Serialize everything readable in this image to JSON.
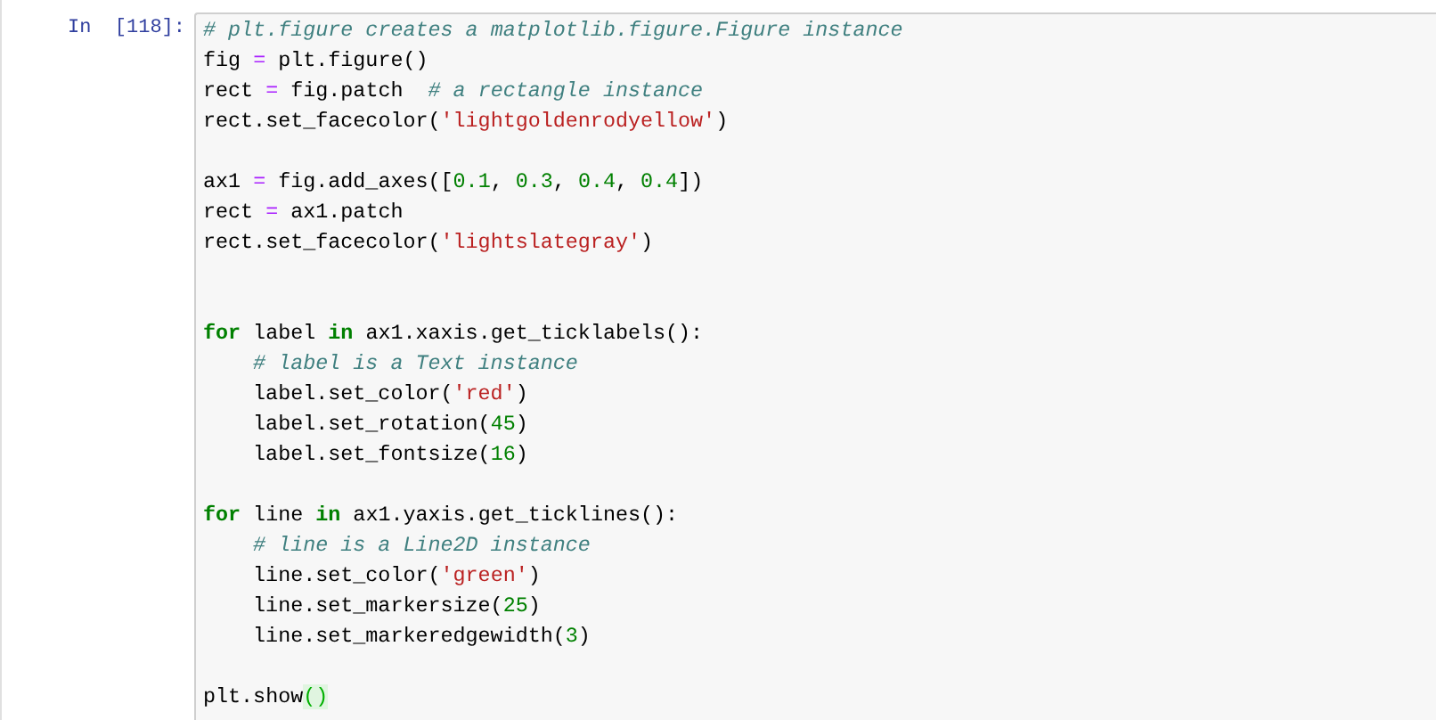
{
  "cell": {
    "prompt": "In  [118]:",
    "lines": [
      {
        "kind": "code",
        "tokens": [
          {
            "kind": "com",
            "text": "# plt.figure creates a matplotlib.figure.Figure instance"
          }
        ]
      },
      {
        "kind": "code",
        "tokens": [
          {
            "kind": "plain",
            "text": "fig "
          },
          {
            "kind": "op",
            "text": "="
          },
          {
            "kind": "plain",
            "text": " plt.figure()"
          }
        ]
      },
      {
        "kind": "code",
        "tokens": [
          {
            "kind": "plain",
            "text": "rect "
          },
          {
            "kind": "op",
            "text": "="
          },
          {
            "kind": "plain",
            "text": " fig.patch  "
          },
          {
            "kind": "com",
            "text": "# a rectangle instance"
          }
        ]
      },
      {
        "kind": "code",
        "tokens": [
          {
            "kind": "plain",
            "text": "rect.set_facecolor("
          },
          {
            "kind": "str",
            "text": "'lightgoldenrodyellow'"
          },
          {
            "kind": "plain",
            "text": ")"
          }
        ]
      },
      {
        "kind": "blank"
      },
      {
        "kind": "code",
        "tokens": [
          {
            "kind": "plain",
            "text": "ax1 "
          },
          {
            "kind": "op",
            "text": "="
          },
          {
            "kind": "plain",
            "text": " fig.add_axes(["
          },
          {
            "kind": "num",
            "text": "0.1"
          },
          {
            "kind": "plain",
            "text": ", "
          },
          {
            "kind": "num",
            "text": "0.3"
          },
          {
            "kind": "plain",
            "text": ", "
          },
          {
            "kind": "num",
            "text": "0.4"
          },
          {
            "kind": "plain",
            "text": ", "
          },
          {
            "kind": "num",
            "text": "0.4"
          },
          {
            "kind": "plain",
            "text": "])"
          }
        ]
      },
      {
        "kind": "code",
        "tokens": [
          {
            "kind": "plain",
            "text": "rect "
          },
          {
            "kind": "op",
            "text": "="
          },
          {
            "kind": "plain",
            "text": " ax1.patch"
          }
        ]
      },
      {
        "kind": "code",
        "tokens": [
          {
            "kind": "plain",
            "text": "rect.set_facecolor("
          },
          {
            "kind": "str",
            "text": "'lightslategray'"
          },
          {
            "kind": "plain",
            "text": ")"
          }
        ]
      },
      {
        "kind": "blank"
      },
      {
        "kind": "blank"
      },
      {
        "kind": "code",
        "tokens": [
          {
            "kind": "kw",
            "text": "for"
          },
          {
            "kind": "plain",
            "text": " label "
          },
          {
            "kind": "kw",
            "text": "in"
          },
          {
            "kind": "plain",
            "text": " ax1.xaxis.get_ticklabels():"
          }
        ]
      },
      {
        "kind": "code",
        "indented": true,
        "tokens": [
          {
            "kind": "com",
            "text": "# label is a Text instance"
          }
        ]
      },
      {
        "kind": "code",
        "indented": true,
        "tokens": [
          {
            "kind": "plain",
            "text": "label.set_color("
          },
          {
            "kind": "str",
            "text": "'red'"
          },
          {
            "kind": "plain",
            "text": ")"
          }
        ]
      },
      {
        "kind": "code",
        "indented": true,
        "tokens": [
          {
            "kind": "plain",
            "text": "label.set_rotation("
          },
          {
            "kind": "num",
            "text": "45"
          },
          {
            "kind": "plain",
            "text": ")"
          }
        ]
      },
      {
        "kind": "code",
        "indented": true,
        "tokens": [
          {
            "kind": "plain",
            "text": "label.set_fontsize("
          },
          {
            "kind": "num",
            "text": "16"
          },
          {
            "kind": "plain",
            "text": ")"
          }
        ]
      },
      {
        "kind": "blank"
      },
      {
        "kind": "code",
        "tokens": [
          {
            "kind": "kw",
            "text": "for"
          },
          {
            "kind": "plain",
            "text": " line "
          },
          {
            "kind": "kw",
            "text": "in"
          },
          {
            "kind": "plain",
            "text": " ax1.yaxis.get_ticklines():"
          }
        ]
      },
      {
        "kind": "code",
        "indented": true,
        "tokens": [
          {
            "kind": "com",
            "text": "# line is a Line2D instance"
          }
        ]
      },
      {
        "kind": "code",
        "indented": true,
        "tokens": [
          {
            "kind": "plain",
            "text": "line.set_color("
          },
          {
            "kind": "str",
            "text": "'green'"
          },
          {
            "kind": "plain",
            "text": ")"
          }
        ]
      },
      {
        "kind": "code",
        "indented": true,
        "tokens": [
          {
            "kind": "plain",
            "text": "line.set_markersize("
          },
          {
            "kind": "num",
            "text": "25"
          },
          {
            "kind": "plain",
            "text": ")"
          }
        ]
      },
      {
        "kind": "code",
        "indented": true,
        "tokens": [
          {
            "kind": "plain",
            "text": "line.set_markeredgewidth("
          },
          {
            "kind": "num",
            "text": "3"
          },
          {
            "kind": "plain",
            "text": ")"
          }
        ]
      },
      {
        "kind": "blank"
      },
      {
        "kind": "code",
        "tokens": [
          {
            "kind": "plain",
            "text": "plt.show"
          },
          {
            "kind": "match",
            "text": "()"
          }
        ]
      }
    ]
  }
}
